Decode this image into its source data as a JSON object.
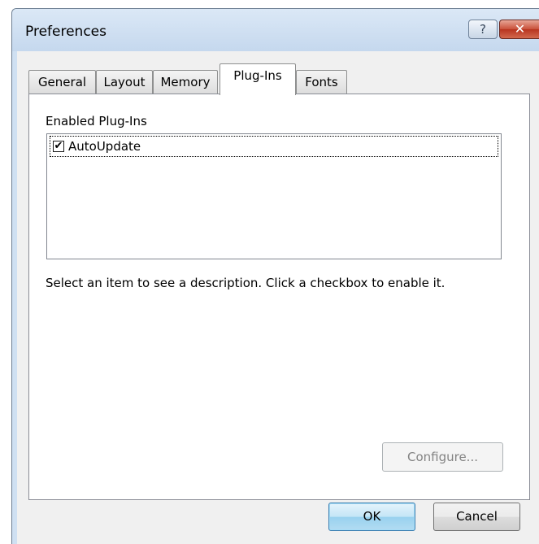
{
  "window": {
    "title": "Preferences",
    "help_glyph": "?",
    "close_glyph": "✕"
  },
  "tabs": [
    {
      "label": "General",
      "active": false
    },
    {
      "label": "Layout",
      "active": false
    },
    {
      "label": "Memory",
      "active": false
    },
    {
      "label": "Plug-Ins",
      "active": true
    },
    {
      "label": "Fonts",
      "active": false
    }
  ],
  "plugins": {
    "group_label": "Enabled Plug-Ins",
    "items": [
      {
        "label": "AutoUpdate",
        "checked": true,
        "check_glyph": "✔"
      }
    ],
    "description": "Select an item to see a description.  Click a checkbox to enable it.",
    "configure_label": "Configure..."
  },
  "footer": {
    "ok_label": "OK",
    "cancel_label": "Cancel"
  },
  "colors": {
    "title_bar": "#cfe0f2",
    "close_button": "#c9503a",
    "default_button": "#98d1ef"
  }
}
